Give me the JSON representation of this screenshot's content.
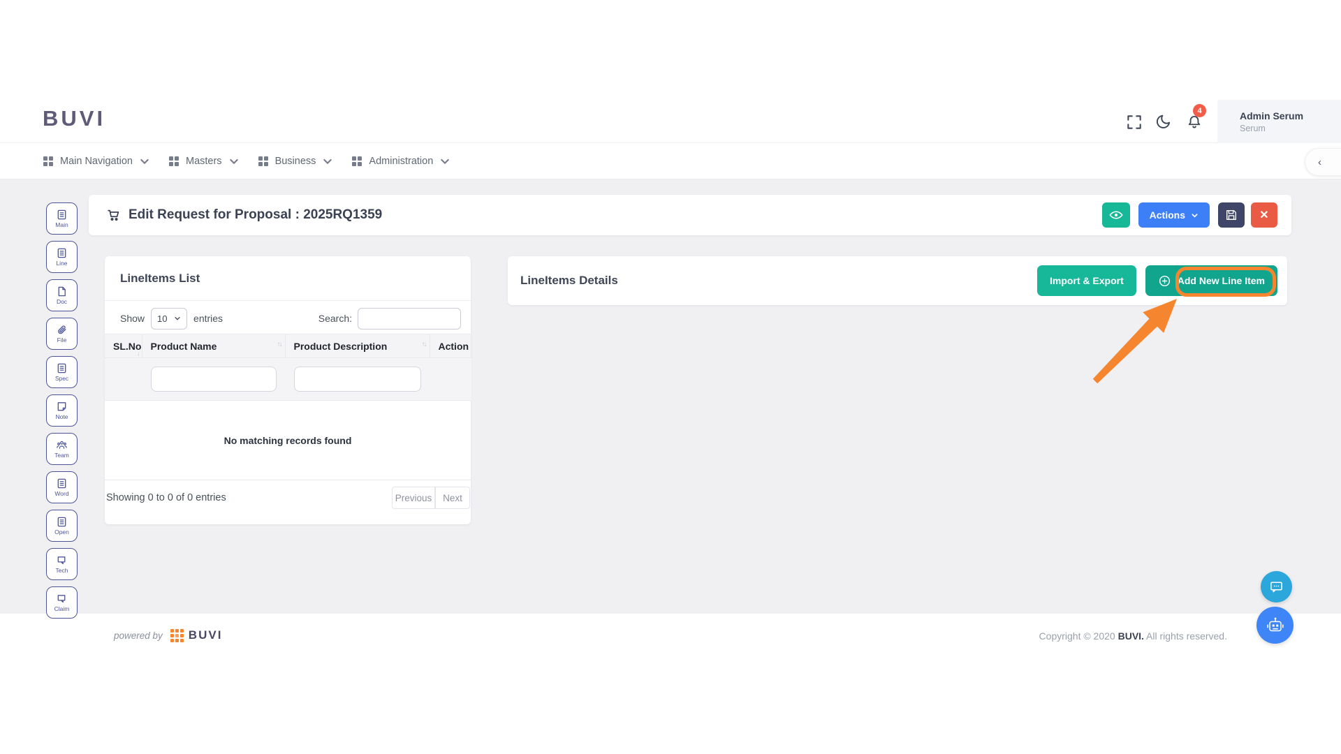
{
  "brand": {
    "logo": "BUVI"
  },
  "header": {
    "notification_count": "4",
    "user": {
      "name": "Admin Serum",
      "role": "Serum"
    }
  },
  "navbar": {
    "items": [
      {
        "label": "Main Navigation"
      },
      {
        "label": "Masters"
      },
      {
        "label": "Business"
      },
      {
        "label": "Administration"
      }
    ]
  },
  "sidebar": {
    "items": [
      {
        "label": "Main",
        "icon": "document-lines-icon"
      },
      {
        "label": "Line",
        "icon": "document-lines-icon"
      },
      {
        "label": "Doc",
        "icon": "page-icon"
      },
      {
        "label": "File",
        "icon": "paperclip-icon"
      },
      {
        "label": "Spec",
        "icon": "document-lines-icon"
      },
      {
        "label": "Note",
        "icon": "note-icon"
      },
      {
        "label": "Team",
        "icon": "team-icon"
      },
      {
        "label": "Word",
        "icon": "document-lines-icon"
      },
      {
        "label": "Open",
        "icon": "document-lines-icon"
      },
      {
        "label": "Tech",
        "icon": "chat-icon"
      },
      {
        "label": "Claim",
        "icon": "chat-icon"
      }
    ]
  },
  "title_bar": {
    "title": "Edit Request for Proposal : 2025RQ1359",
    "actions_label": "Actions",
    "close_label": "✕"
  },
  "lineitems_list": {
    "title": "LineItems List",
    "show_label": "Show",
    "page_size": "10",
    "entries_label": "entries",
    "search_label": "Search:",
    "columns": [
      "SL.No",
      "Product Name",
      "Product Description",
      "Action"
    ],
    "empty_message": "No matching records found",
    "summary": "Showing 0 to 0 of 0 entries",
    "pagination": {
      "previous": "Previous",
      "next": "Next"
    }
  },
  "lineitems_details": {
    "title": "LineItems Details",
    "import_export_label": "Import & Export",
    "add_new_label": "Add New Line Item"
  },
  "footer": {
    "powered_by": "powered by",
    "brand": "BUVI",
    "copyright_prefix": "Copyright © 2020 ",
    "copyright_brand": "BUVI.",
    "copyright_suffix": " All rights reserved."
  },
  "colors": {
    "accent_teal": "#17b79a",
    "accent_teal_dark": "#12a58e",
    "accent_blue": "#3d7ff7",
    "accent_dark_indigo": "#3e4566",
    "accent_red": "#ea5b45",
    "badge_red": "#f25d4a",
    "annotation_orange": "#f5862f",
    "sidebar_indigo": "#4c5499",
    "content_bg": "#f0f0f3"
  }
}
